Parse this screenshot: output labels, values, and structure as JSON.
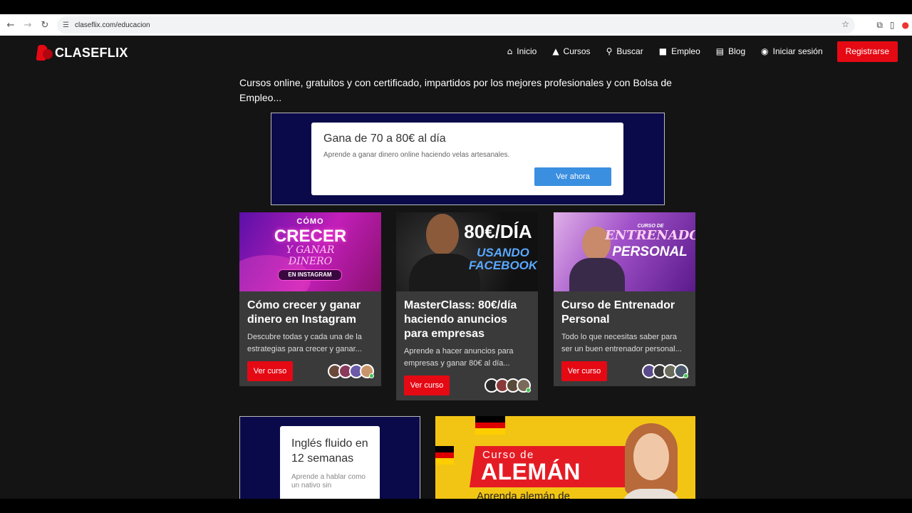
{
  "browser": {
    "url": "claseflix.com/educacion",
    "back_icon": "arrow-left-icon",
    "forward_icon": "arrow-right-icon",
    "reload_icon": "reload-icon"
  },
  "header": {
    "logo_text": "CLASEFLIX",
    "nav": [
      {
        "label": "Inicio",
        "icon": "home-icon"
      },
      {
        "label": "Cursos",
        "icon": "graduation-cap-icon"
      },
      {
        "label": "Buscar",
        "icon": "search-icon"
      },
      {
        "label": "Empleo",
        "icon": "briefcase-icon"
      },
      {
        "label": "Blog",
        "icon": "newspaper-icon"
      },
      {
        "label": "Iniciar sesión",
        "icon": "user-circle-icon"
      }
    ],
    "register_label": "Registrarse"
  },
  "intro": "Cursos online, gratuitos y con certificado, impartidos por los mejores profesionales y con Bolsa de Empleo...",
  "ad_top": {
    "title": "Gana de 70 a 80€ al día",
    "subtitle": "Aprende a ganar dinero online haciendo velas artesanales.",
    "cta": "Ver ahora"
  },
  "courses": [
    {
      "thumb_lines": [
        "CÓMO",
        "CRECER",
        "Y GANAR",
        "DINERO",
        "EN INSTAGRAM"
      ],
      "title": "Cómo crecer y ganar dinero en Instagram",
      "description": "Descubre todas y cada una de la estrategias para crecer y ganar...",
      "button": "Ver curso"
    },
    {
      "thumb_lines": [
        "80€/DÍA",
        "USANDO",
        "FACEBOOK"
      ],
      "title": "MasterClass: 80€/día haciendo anuncios para empresas",
      "description": "Aprende a hacer anuncios para empresas y ganar 80€ al día...",
      "button": "Ver curso"
    },
    {
      "thumb_lines": [
        "CURSO DE",
        "ENTRENADOR",
        "PERSONAL"
      ],
      "title": "Curso de Entrenador Personal",
      "description": "Todo lo que necesitas saber para ser un buen entrenador personal...",
      "button": "Ver curso"
    }
  ],
  "ad_bottom_left": {
    "title": "Inglés fluido en 12 semanas",
    "subtitle": "Aprende a hablar como un nativo sin"
  },
  "ad_bottom_right": {
    "line1": "Curso de",
    "line2": "ALEMÁN",
    "line3": "Aprenda alemán de"
  },
  "colors": {
    "brand_red": "#e50914",
    "ad_blue": "#0a0a4a",
    "ad_yellow": "#f2c515",
    "cta_blue": "#3b8fe0"
  }
}
